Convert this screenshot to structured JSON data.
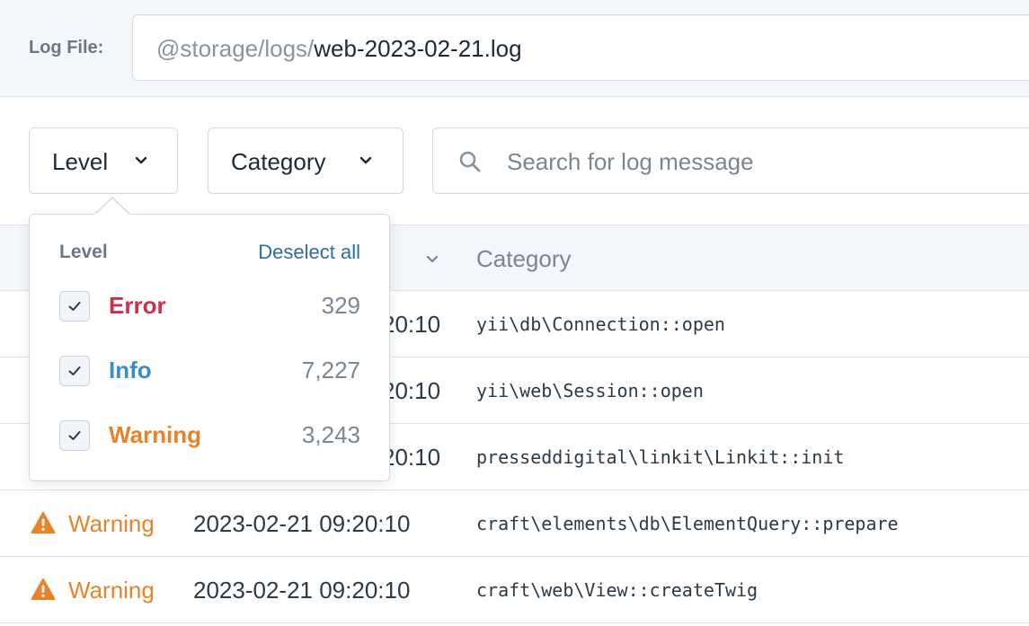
{
  "log_file": {
    "label": "Log File:",
    "path_prefix": "@storage/logs/",
    "file_name": "web-2023-02-21.log"
  },
  "filters": {
    "level_label": "Level",
    "category_label": "Category",
    "search_placeholder": "Search for log message"
  },
  "table": {
    "category_header": "Category",
    "rows": [
      {
        "level": "",
        "timestamp": "20:10",
        "category": "yii\\db\\Connection::open"
      },
      {
        "level": "",
        "timestamp": "20:10",
        "category": "yii\\web\\Session::open"
      },
      {
        "level": "",
        "timestamp": "20:10",
        "category": "presseddigital\\linkit\\Linkit::init"
      },
      {
        "level": "Warning",
        "timestamp": "2023-02-21 09:20:10",
        "category": "craft\\elements\\db\\ElementQuery::prepare"
      },
      {
        "level": "Warning",
        "timestamp": "2023-02-21 09:20:10",
        "category": "craft\\web\\View::createTwig"
      }
    ]
  },
  "level_dropdown": {
    "title": "Level",
    "deselect_label": "Deselect all",
    "items": [
      {
        "name": "Error",
        "count": "329",
        "color": "#c8324c",
        "checked": true
      },
      {
        "name": "Info",
        "count": "7,227",
        "color": "#3a8dc9",
        "checked": true
      },
      {
        "name": "Warning",
        "count": "3,243",
        "color": "#e8832c",
        "checked": true
      }
    ]
  },
  "colors": {
    "warning": "#e8832c",
    "error": "#c8324c",
    "info": "#3a8dc9",
    "link": "#2e6da4"
  },
  "icons": {
    "search": "search-icon",
    "warning": "warning-triangle-icon",
    "chevron": "chevron-down-icon",
    "check": "check-icon"
  }
}
